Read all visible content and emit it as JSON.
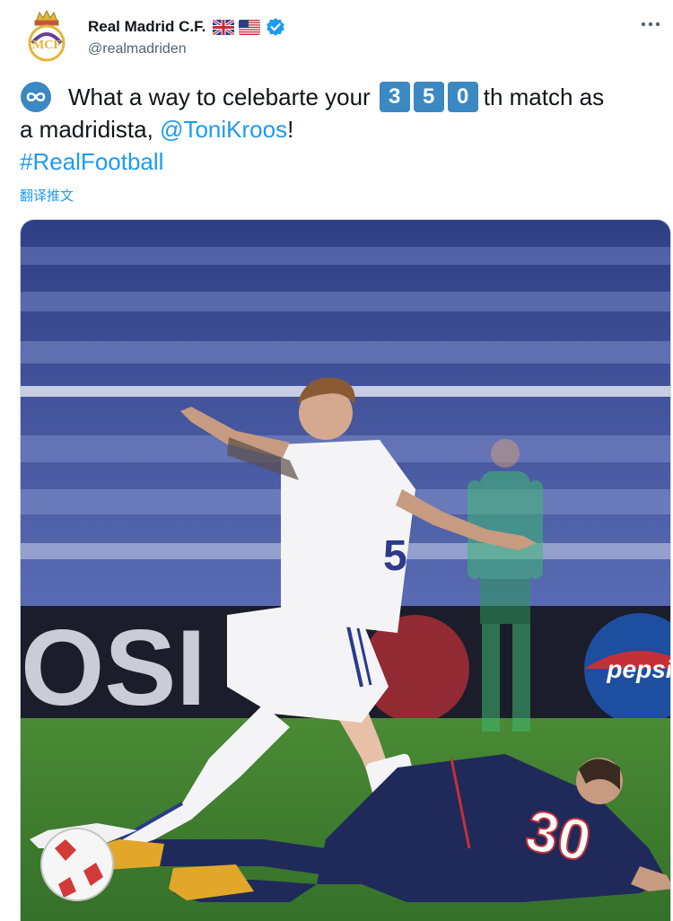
{
  "tweet": {
    "author": {
      "display_name": "Real Madrid C.F.",
      "handle": "@realmadriden",
      "verified": true,
      "flags": [
        "uk-flag-icon",
        "us-flag-icon"
      ]
    },
    "text": {
      "prefix": "What a way to celebarte your",
      "digits": [
        "3",
        "5",
        "0"
      ],
      "after_digits": "th match as",
      "line2_start": "a madridista,",
      "mention": "@ToniKroos",
      "line2_end": "!",
      "hashtag": "#RealFootball"
    },
    "translate_label": "翻译推文",
    "media": {
      "type": "photo",
      "shirt_number": "30",
      "colors": {
        "stands": "#3c4f9a",
        "pitch": "#3f7a2c",
        "white_kit": "#f4f4f6",
        "navy_kit": "#1f2a5a"
      }
    }
  },
  "icons": {
    "avatar": "real-madrid-crest-icon",
    "more": "more-dots-icon",
    "verified": "verified-badge-icon",
    "infinity": "infinity-icon"
  }
}
